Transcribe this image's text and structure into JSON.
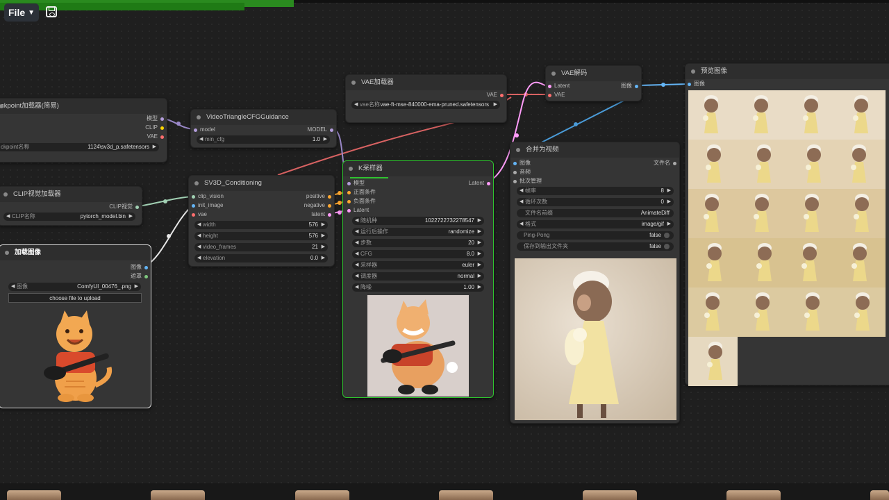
{
  "menu": {
    "file_label": "File",
    "chevron": "chevron-down-icon",
    "save_icon": "save-icon"
  },
  "nodes": {
    "checkpoint": {
      "title": "ckpoint加载器(简易)",
      "outputs": [
        "模型",
        "CLIP",
        "VAE"
      ],
      "widget_label": "ckpoint名称",
      "widget_value": "1124\\sv3d_p.safetensors"
    },
    "clip_vision": {
      "title": "CLIP视觉加载器",
      "output": "CLIP视觉",
      "widget_label": "CLIP名称",
      "widget_value": "pytorch_model.bin"
    },
    "load_image": {
      "title": "加载图像",
      "outputs": [
        "图像",
        "遮罩"
      ],
      "widget_label": "图像",
      "widget_value": "ComfyUI_00476_.png",
      "upload_label": "choose file to upload"
    },
    "cfg_guidance": {
      "title": "VideoTriangleCFGGuidance",
      "input": "model",
      "output": "MODEL",
      "widget_label": "min_cfg",
      "widget_value": "1.0"
    },
    "sv3d": {
      "title": "SV3D_Conditioning",
      "inputs": [
        "clip_vision",
        "init_image",
        "vae"
      ],
      "outputs": [
        "positive",
        "negative",
        "latent"
      ],
      "widgets": [
        {
          "label": "width",
          "value": "576"
        },
        {
          "label": "height",
          "value": "576"
        },
        {
          "label": "video_frames",
          "value": "21"
        },
        {
          "label": "elevation",
          "value": "0.0"
        }
      ]
    },
    "vae_loader": {
      "title": "VAE加载器",
      "output": "VAE",
      "widget_label": "vae名称",
      "widget_value": "vae-ft-mse-840000-ema-pruned.safetensors"
    },
    "ksampler": {
      "title": "K采样器",
      "inputs": [
        "模型",
        "正面条件",
        "负面条件",
        "Latent"
      ],
      "output": "Latent",
      "widgets": [
        {
          "label": "随机种",
          "value": "1022722732278547"
        },
        {
          "label": "运行后操作",
          "value": "randomize"
        },
        {
          "label": "步数",
          "value": "20"
        },
        {
          "label": "CFG",
          "value": "8.0"
        },
        {
          "label": "采样器",
          "value": "euler"
        },
        {
          "label": "调度器",
          "value": "normal"
        },
        {
          "label": "降噪",
          "value": "1.00"
        }
      ]
    },
    "vae_decode": {
      "title": "VAE解码",
      "inputs": [
        "Latent",
        "VAE"
      ],
      "output": "图像"
    },
    "combine_video": {
      "title": "合并为视频",
      "inputs": [
        "图像",
        "音频",
        "批次管理"
      ],
      "output": "文件名",
      "widgets": [
        {
          "label": "帧率",
          "value": "8"
        },
        {
          "label": "循环次数",
          "value": "0"
        },
        {
          "label": "文件名前缀",
          "value": "AnimateDiff"
        },
        {
          "label": "格式",
          "value": "image/gif"
        },
        {
          "label": "Ping-Pong",
          "value": "false"
        },
        {
          "label": "保存到输出文件夹",
          "value": "false"
        }
      ]
    },
    "preview": {
      "title": "预览图像",
      "input": "图像"
    }
  },
  "colors": {
    "model": "#b39ddb",
    "clip": "#ffd500",
    "vae": "#ff6e6e",
    "image": "#64b5f6",
    "latent": "#ff9cf9",
    "conditioning": "#ffa931",
    "clip_vision": "#a1d0b3",
    "selected_border": "#2fc42f"
  }
}
